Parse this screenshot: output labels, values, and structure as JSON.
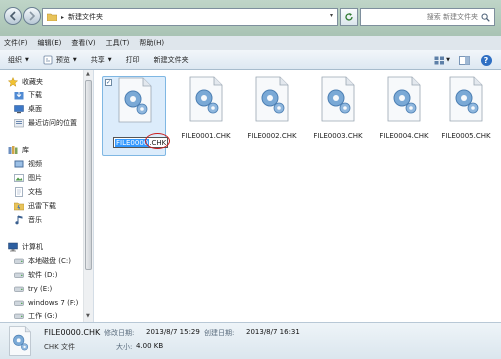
{
  "address": {
    "folder": "新建文件夹",
    "search_placeholder": "搜索 新建文件夹"
  },
  "menu": [
    "文件(F)",
    "编辑(E)",
    "查看(V)",
    "工具(T)",
    "帮助(H)"
  ],
  "toolbar": {
    "organize": "组织",
    "preview": "预览",
    "share": "共享",
    "print": "打印",
    "new_folder": "新建文件夹"
  },
  "nav": {
    "favorites": "收藏夹",
    "downloads": "下载",
    "desktop": "桌面",
    "recent": "最近访问的位置",
    "libraries": "库",
    "videos": "视频",
    "pictures": "图片",
    "documents": "文档",
    "thunder": "迅雷下载",
    "music": "音乐",
    "computer": "计算机",
    "drive_c": "本地磁盘 (C:)",
    "drive_d": "软件 (D:)",
    "drive_e": "try (E:)",
    "drive_f": "windows 7 (F:)",
    "drive_g": "工作 (G:)"
  },
  "files": {
    "rename_selected": "FILE0000",
    "rename_ext": ".CHK",
    "f1": "FILE0001.CHK",
    "f2": "FILE0002.CHK",
    "f3": "FILE0003.CHK",
    "f4": "FILE0004.CHK",
    "f5": "FILE0005.CHK"
  },
  "details": {
    "name": "FILE0000.CHK",
    "type": "CHK 文件",
    "modified_label": "修改日期:",
    "modified_value": "2013/8/7 15:29",
    "created_label": "创建日期:",
    "created_value": "2013/8/7 16:31",
    "size_label": "大小:",
    "size_value": "4.00 KB"
  },
  "colors": {
    "selection": "#dcecfb",
    "highlight": "#3399ff",
    "annotation": "#cc1f1f"
  }
}
